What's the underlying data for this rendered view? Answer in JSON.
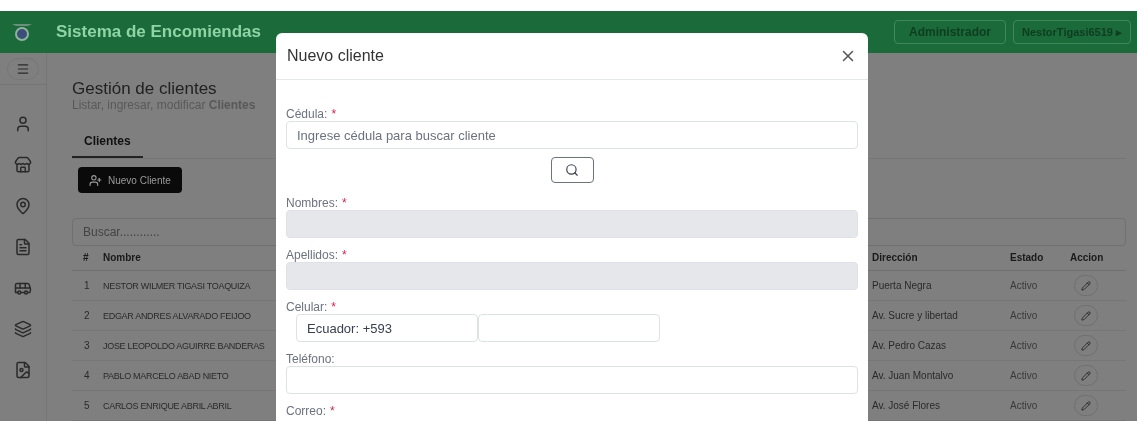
{
  "header": {
    "title": "Sistema de Encomiendas",
    "role": "Administrador",
    "user": "NestorTigasi6519",
    "user_caret": "▸"
  },
  "sidebar": {
    "items": [
      {
        "kind": "user"
      },
      {
        "kind": "store"
      },
      {
        "kind": "location"
      },
      {
        "kind": "document"
      },
      {
        "kind": "bus"
      },
      {
        "kind": "layers"
      },
      {
        "kind": "pdf"
      }
    ]
  },
  "page": {
    "title": "Gestión de clientes",
    "subtitle": "Listar, ingresar, modificar **Clientes**"
  },
  "tabs": [
    {
      "label": "Clientes",
      "selected": true
    }
  ],
  "new_button": "Nuevo Cliente",
  "search": {
    "placeholder": "Buscar............"
  },
  "table": {
    "columns": [
      "#",
      "Nombre",
      "Dirección",
      "Estado",
      "Accion"
    ],
    "rows": [
      {
        "n": "1",
        "name": "NESTOR WILMER TIGASI TOAQUIZA",
        "address": "Puerta Negra",
        "status": "Activo"
      },
      {
        "n": "2",
        "name": "EDGAR ANDRES ALVARADO FEIJOO",
        "address": "Av. Sucre y libertad",
        "status": "Activo"
      },
      {
        "n": "3",
        "name": "JOSE LEOPOLDO AGUIRRE BANDERAS",
        "address": "Av. Pedro Cazas",
        "status": "Activo"
      },
      {
        "n": "4",
        "name": "PABLO MARCELO ABAD NIETO",
        "address": "Av. Juan Montalvo",
        "status": "Activo"
      },
      {
        "n": "5",
        "name": "CARLOS ENRIQUE ABRIL ABRIL",
        "address": "Av. José Flores",
        "status": "Activo"
      }
    ]
  },
  "modal": {
    "title": "Nuevo cliente",
    "fields": [
      {
        "kind": "search",
        "label": "Cédula:",
        "required_mark": "*",
        "placeholder": "Ingrese cédula para buscar cliente",
        "disabled": false
      },
      {
        "kind": "text",
        "label": "Nombres:",
        "required_mark": "*",
        "disabled": true
      },
      {
        "kind": "text",
        "label": "Apellidos:",
        "required_mark": "*",
        "disabled": true
      },
      {
        "kind": "phone",
        "label": "Celular:",
        "required_mark": "*",
        "value": "Ecuador: +593",
        "disabled": false
      },
      {
        "kind": "text",
        "label": "Teléfono:",
        "disabled": false
      },
      {
        "kind": "label",
        "label": "Correo:",
        "required_mark": "*"
      }
    ]
  }
}
